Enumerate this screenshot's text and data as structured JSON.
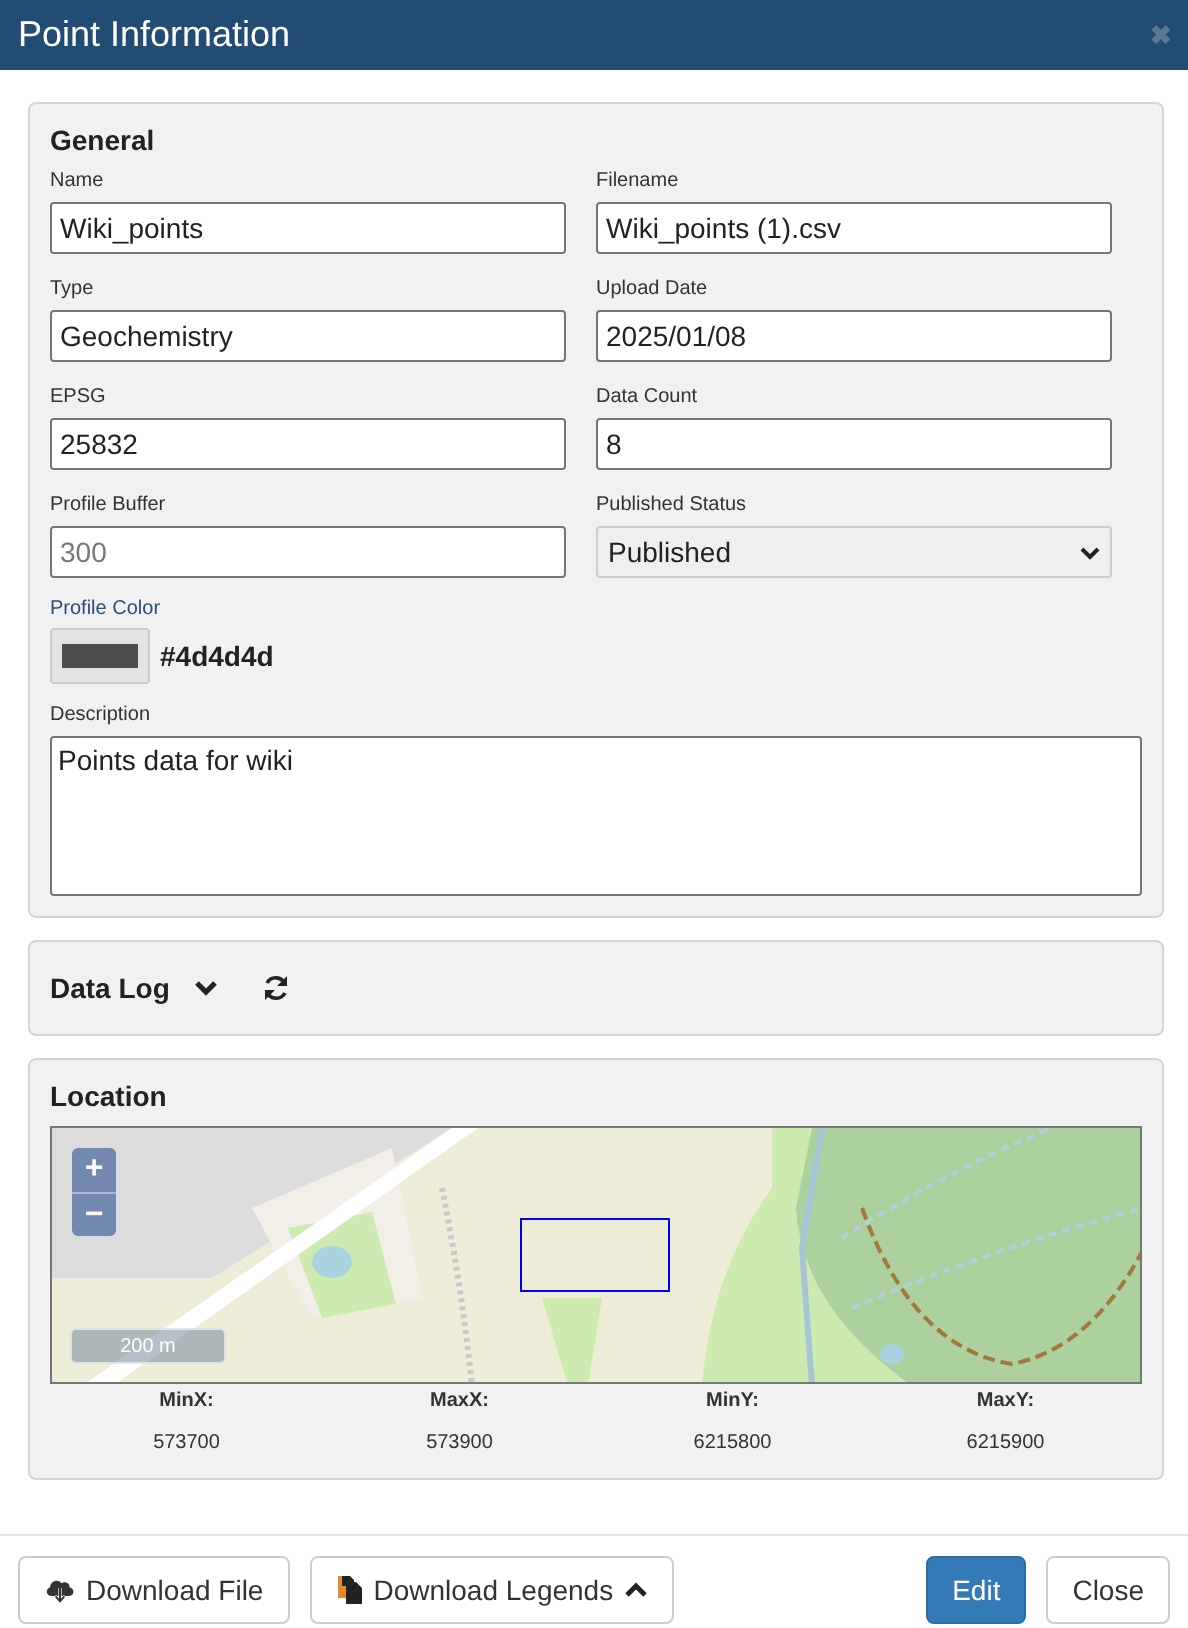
{
  "dialog": {
    "title": "Point Information",
    "close": "✖"
  },
  "general": {
    "title": "General",
    "fields": [
      {
        "label": "Name",
        "kind": "text",
        "value": "Wiki_points"
      },
      {
        "label": "Filename",
        "kind": "text",
        "value": "Wiki_points (1).csv"
      },
      {
        "label": "Type",
        "kind": "text",
        "value": "Geochemistry"
      },
      {
        "label": "Upload Date",
        "kind": "text",
        "value": "2025/01/08"
      },
      {
        "label": "EPSG",
        "kind": "text",
        "value": "25832"
      },
      {
        "label": "Data Count",
        "kind": "text",
        "value": "8"
      },
      {
        "label": "Profile Buffer",
        "kind": "text",
        "placeholder": "300"
      },
      {
        "label": "Published Status",
        "kind": "select",
        "value": "Published"
      }
    ],
    "profile_color": {
      "label": "Profile Color",
      "color": "#4d4d4d",
      "value": "#4d4d4d"
    },
    "description": {
      "label": "Description",
      "value": "Points data for wiki"
    }
  },
  "data_log": {
    "title": "Data Log",
    "expanded": false
  },
  "location": {
    "title": "Location",
    "map": {
      "kind": "picture",
      "zoom_in": "+",
      "zoom_out": "−",
      "scale": "200 m"
    },
    "bounds": [
      {
        "label": "MinX:",
        "value": "573700"
      },
      {
        "label": "MaxX:",
        "value": "573900"
      },
      {
        "label": "MinY:",
        "value": "6215800"
      },
      {
        "label": "MaxY:",
        "value": "6215900"
      }
    ]
  },
  "buttons": [
    {
      "label": "Download File",
      "kind": "download"
    },
    {
      "label": "Download Legends",
      "kind": "legends"
    },
    {
      "label": "Edit",
      "kind": "primary"
    },
    {
      "label": "Close",
      "kind": "default"
    }
  ]
}
